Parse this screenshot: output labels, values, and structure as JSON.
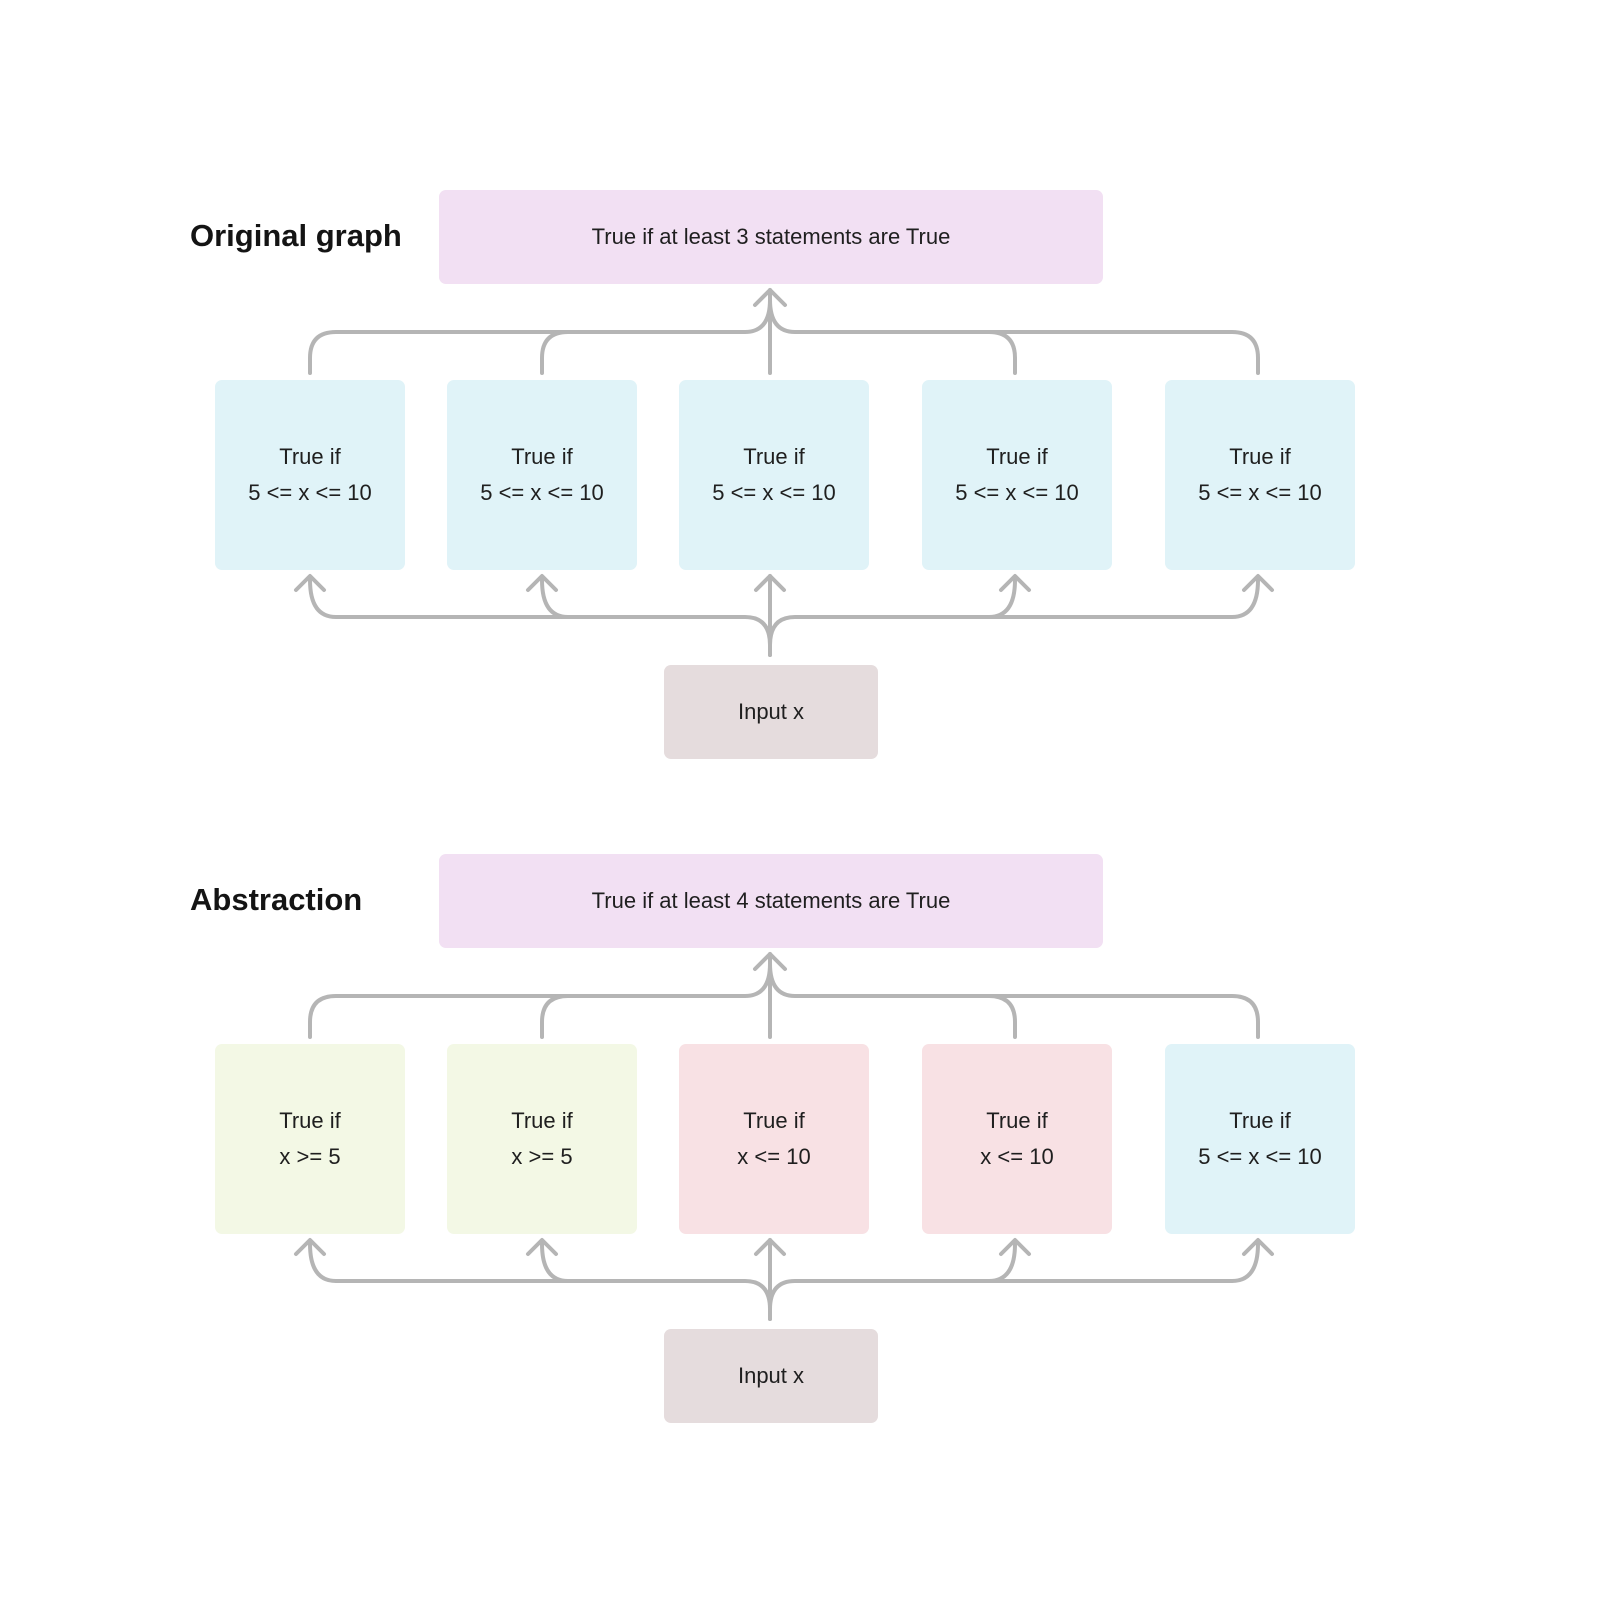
{
  "sections": [
    {
      "title": "Original graph",
      "aggregator": "True if at least 3 statements are True",
      "input": "Input x",
      "nodes": [
        {
          "line1": "True if",
          "line2": "5 <= x <= 10",
          "color": "blue"
        },
        {
          "line1": "True if",
          "line2": "5 <= x <= 10",
          "color": "blue"
        },
        {
          "line1": "True if",
          "line2": "5 <= x <= 10",
          "color": "blue"
        },
        {
          "line1": "True if",
          "line2": "5 <= x <= 10",
          "color": "blue"
        },
        {
          "line1": "True if",
          "line2": "5 <= x <= 10",
          "color": "blue"
        }
      ]
    },
    {
      "title": "Abstraction",
      "aggregator": "True if at least 4 statements are True",
      "input": "Input x",
      "nodes": [
        {
          "line1": "True if",
          "line2": "x >= 5",
          "color": "green"
        },
        {
          "line1": "True if",
          "line2": "x >= 5",
          "color": "green"
        },
        {
          "line1": "True if",
          "line2": "x <= 10",
          "color": "pink"
        },
        {
          "line1": "True if",
          "line2": "x <= 10",
          "color": "pink"
        },
        {
          "line1": "True if",
          "line2": "5 <= x <= 10",
          "color": "blue"
        }
      ]
    }
  ],
  "colors": {
    "aggregator": "#f2e0f3",
    "input": "#e5dcdd",
    "blue": "#e0f3f8",
    "green": "#f3f8e5",
    "pink": "#f8e1e4",
    "edge": "#b5b5b5"
  }
}
